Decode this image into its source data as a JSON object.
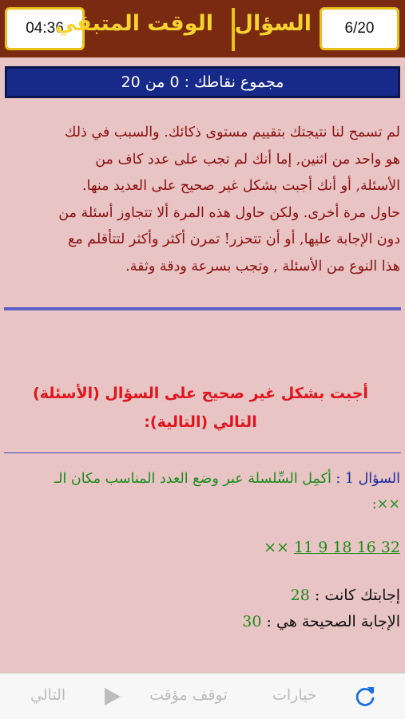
{
  "header": {
    "timer_value": "04:36",
    "time_remaining_label": "الوقت المتبقي",
    "question_label": "السؤال",
    "question_progress": "6/20"
  },
  "score_text": "مجموع نقاطك : 0 من 20",
  "feedback": [
    "لم تسمح لنا نتيجتك بتقييم مستوى ذكائك. والسبب في ذلك",
    "هو واحد من اثنين, إما أنك لم تجب على عدد كاف من",
    "الأسئلة, أو أنك أجبت بشكل غير صحيح على العديد منها.",
    "حاول مرة أخرى. ولكن حاول هذه المرة ألا تتجاوز أسئلة من",
    "دون الإجابة عليها, أو أن تتحزر! تمرن أكثر وأكثر لتتأقلم مع",
    "هذا النوع من الأسئلة , وتجب بسرعة ودقة وثقة."
  ],
  "wrong_heading": "أجبت بشكل غير صحيح على السؤال (الأسئلة) التالي (التالية):",
  "question": {
    "label": "السؤال 1 :",
    "text_line1": "أكمِل السِّلسلة عبر وضع العدد المناسب مكان الـ",
    "text_line2": "××:",
    "sequence": "32 16 18 9 11",
    "placeholder": "××"
  },
  "your_answer": {
    "label": "إجابتك كانت :",
    "value": "28"
  },
  "correct_answer": {
    "label": "الإجابة الصحيحة هي :",
    "value": "30"
  },
  "toolbar": {
    "next_label": "التالي",
    "pause_label": "توقف مؤقت",
    "options_label": "خيارات",
    "accent_color": "#1a6fe0",
    "disabled_color": "#bdbdbd"
  }
}
